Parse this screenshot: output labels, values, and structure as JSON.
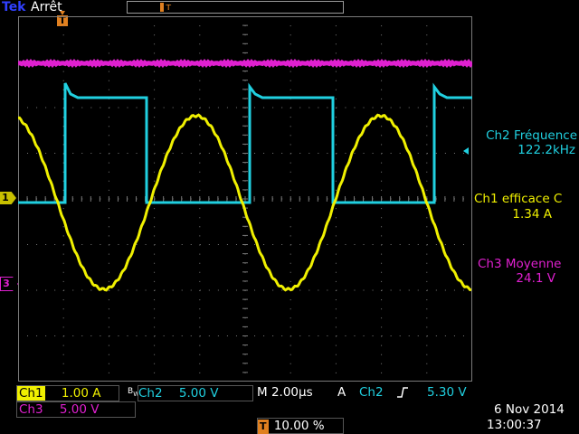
{
  "header": {
    "brand": "Tek",
    "state": "Arrêt",
    "trigger_marker": "T"
  },
  "colors": {
    "ch1": "#f0f000",
    "ch2": "#20d0e0",
    "ch3": "#e020d0",
    "grid": "#7a7a7a",
    "brand": "#3040ff"
  },
  "markers": {
    "ch1": "1",
    "ch3": "3"
  },
  "measurements": [
    {
      "label": "Ch2 Fréquence",
      "value": "122.2kHz",
      "channel": "ch2"
    },
    {
      "label": "Ch1 efficace C",
      "value": "1.34 A",
      "channel": "ch1"
    },
    {
      "label": "Ch3 Moyenne",
      "value": "24.1 V",
      "channel": "ch3"
    }
  ],
  "status": {
    "ch1_name": "Ch1",
    "ch1_scale": "1.00 A",
    "bw_icon": "bandwidth-limit-icon",
    "ch2_name": "Ch2",
    "ch2_scale": "5.00 V",
    "timebase": "M 2.00µs",
    "trigger_mode": "A",
    "trigger_source": "Ch2",
    "trigger_slope_icon": "rising-edge-icon",
    "trigger_level": "5.30 V",
    "ch3_name": "Ch3",
    "ch3_scale": "5.00 V",
    "trigger_pos_tag": "T",
    "trigger_pos": "10.00 %",
    "date": "6 Nov 2014",
    "time": "13:00:37"
  }
}
